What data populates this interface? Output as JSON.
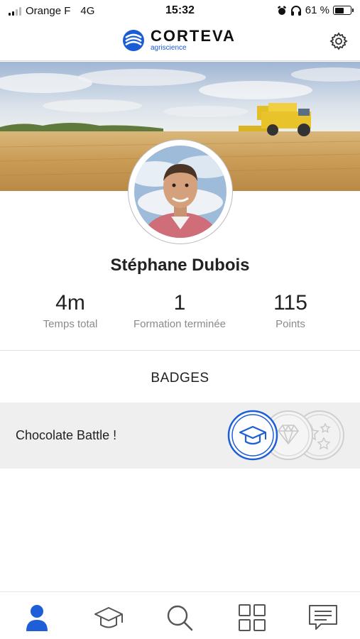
{
  "status_bar": {
    "carrier": "Orange F",
    "network": "4G",
    "time": "15:32",
    "battery_percent": "61 %",
    "battery_level": 0.61,
    "signal_bars": 2
  },
  "header": {
    "logo_name": "CORTEVA",
    "logo_subtitle": "agriscience",
    "logo_icon": "corteva-logo-icon",
    "settings_icon": "gear-icon"
  },
  "profile": {
    "name": "Stéphane Dubois",
    "stats": [
      {
        "value": "4m",
        "label": "Temps total"
      },
      {
        "value": "1",
        "label": "Formation terminée"
      },
      {
        "value": "115",
        "label": "Points"
      }
    ]
  },
  "badges": {
    "title": "BADGES",
    "items": [
      {
        "name": "Chocolate Battle !",
        "icons": [
          "graduation-cap-icon",
          "diamond-icon",
          "stars-icon"
        ]
      }
    ]
  },
  "bottom_nav": {
    "items": [
      {
        "icon": "profile-icon",
        "active": true
      },
      {
        "icon": "graduation-cap-icon",
        "active": false
      },
      {
        "icon": "search-icon",
        "active": false
      },
      {
        "icon": "grid-icon",
        "active": false
      },
      {
        "icon": "messages-icon",
        "active": false
      }
    ]
  },
  "colors": {
    "accent": "#1a5bd6",
    "active_nav": "#1e5fd8",
    "inactive_icon": "#555555",
    "badge_row_bg": "#efefef"
  }
}
